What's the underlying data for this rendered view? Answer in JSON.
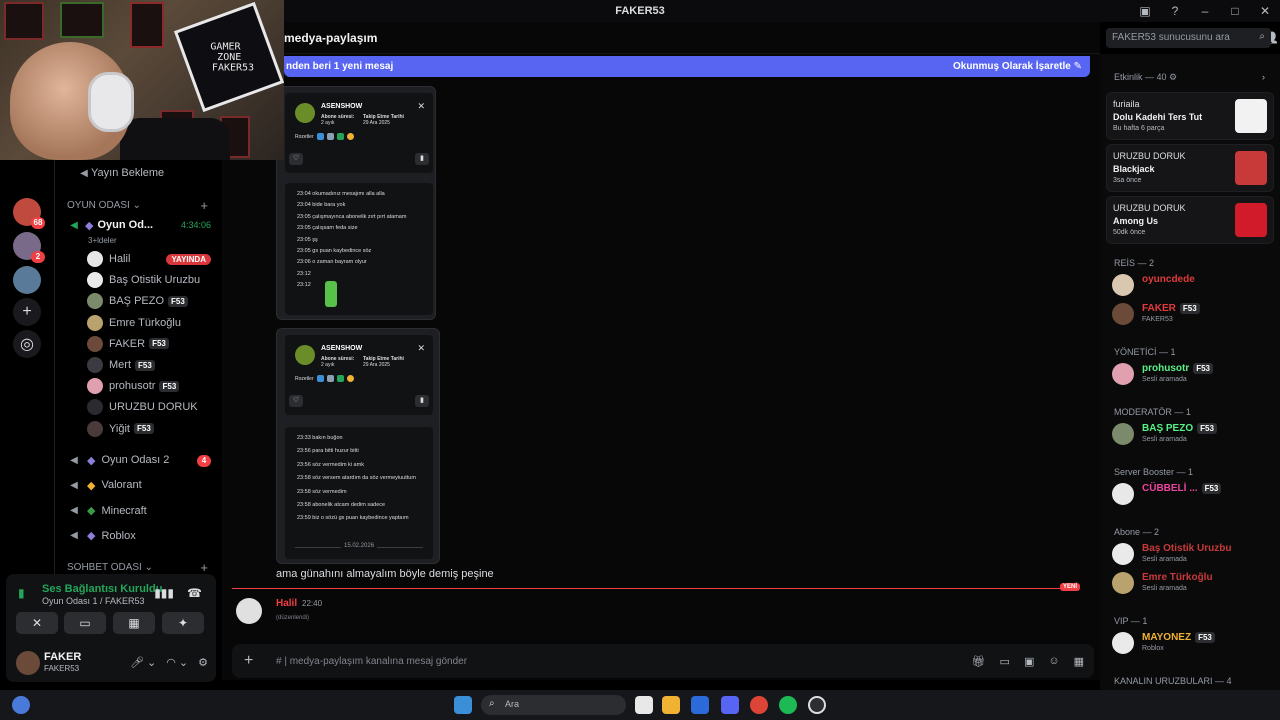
{
  "window": {
    "title": "FAKER53"
  },
  "webcam": {
    "logo_line1": "GAMER",
    "logo_line2": "ZONE",
    "logo_line3": "FAKER53"
  },
  "servers": [
    {
      "badge": "68",
      "color": "#c04a3e"
    },
    {
      "badge": "2",
      "color": "#7a6a8a"
    },
    {
      "badge": "",
      "color": "#5a7a9a"
    }
  ],
  "channels": {
    "top_item": "Yayın Bekleme",
    "category_oyun": "OYUN ODASI",
    "active_channel": "Oyun Od...",
    "active_timer": "4:34:06",
    "active_sub": "3+ldeler",
    "voice_users": [
      {
        "name": "Halil",
        "tag": "",
        "live": "YAYINDA",
        "color": "#dbdee1",
        "av": "#e6e6e6"
      },
      {
        "name": "Baş Otistik Uruzbu",
        "tag": "",
        "live": "",
        "color": "#dbdee1",
        "av": "#eaeaea"
      },
      {
        "name": "BAŞ PEZO",
        "tag": "F53",
        "live": "",
        "color": "#dbdee1",
        "av": "#7a8a6a"
      },
      {
        "name": "Emre Türkoğlu",
        "tag": "",
        "live": "",
        "color": "#dbdee1",
        "av": "#b9a26e"
      },
      {
        "name": "FAKER",
        "tag": "F53",
        "live": "",
        "color": "#dbdee1",
        "av": "#6b4a3a"
      },
      {
        "name": "Mert",
        "tag": "F53",
        "live": "",
        "color": "#dbdee1",
        "av": "#3a3a40"
      },
      {
        "name": "prohusotr",
        "tag": "F53",
        "live": "",
        "color": "#dbdee1",
        "av": "#e0a0b0"
      },
      {
        "name": "URUZBU DORUK",
        "tag": "",
        "live": "",
        "color": "#dbdee1",
        "av": "#2a2a30"
      },
      {
        "name": "Yiğit",
        "tag": "F53",
        "live": "",
        "color": "#dbdee1",
        "av": "#4a3a3a"
      }
    ],
    "other_voice": [
      {
        "name": "Oyun Odası 2",
        "badge": "4"
      },
      {
        "name": "Valorant",
        "badge": ""
      },
      {
        "name": "Minecraft",
        "badge": ""
      },
      {
        "name": "Roblox",
        "badge": ""
      }
    ],
    "category_sohbet": "SOHBET ODASI"
  },
  "voice_panel": {
    "status": "Ses Bağlantısı Kuruldu",
    "location": "Oyun Odası 1 / FAKER53",
    "user_name": "FAKER",
    "user_status": "FAKER53"
  },
  "chat": {
    "channel_name": "medya-paylaşım",
    "search_placeholder": "FAKER53 sunucusunu ara",
    "new_messages_text": "nden beri 1 yeni mesaj",
    "mark_read": "Okunmuş Olarak İşaretle",
    "card1": {
      "name": "ASENSHOW",
      "sub_label": "Abone süresi:",
      "sub_value": "2 ayık",
      "follow_label": "Takip Etme Tarihi",
      "follow_value": "29 Ara 2025",
      "rozetler": "Rozetler",
      "lines": [
        "23:04 okumadınız mesajımı alla alla",
        "23:04 bide bara yok",
        "23:05 çalışmayınca abonelik zırt pırt atamam",
        "23:05 çalışsam feda size",
        "23:05 şş",
        "23:05 gs puan kaybedince söz",
        "23:06 o zaman bayram olyur",
        "23:12",
        "23:12"
      ]
    },
    "card2": {
      "name": "ASENSHOW",
      "sub_label": "Abone süresi:",
      "sub_value": "2 ayık",
      "follow_label": "Takip Etme Tarihi",
      "follow_value": "29 Ara 2025",
      "rozetler": "Rozetler",
      "lines": [
        "23:33 bakın buğon",
        "23:56 para bitti huzur bitti",
        "23:56 söz vermedim ki amk",
        "23:58 söz versem atardım da söz vermeyiuuttum",
        "23:58 söz vermedim",
        "23:58 abonelik atcam dedim sadece",
        "23:59 biz o sözü gs puan kaybedince yaptaım"
      ],
      "date": "15.02.2026"
    },
    "message1": "ama günahını almayalım böyle demiş peşine",
    "new_label": "YENİ",
    "message2": {
      "author": "Halil",
      "time": "22:40",
      "text": "(düzenlendi)"
    },
    "composer_placeholder": "medya-paylaşım kanalına mesaj gönder"
  },
  "members": {
    "activity_header": "Etkinlik — 40",
    "activities": [
      {
        "who": "furiaila",
        "game": "Dolu Kadehi Ters Tut",
        "when": "Bu hafta 6 parça",
        "thumb": "#f2f2f2"
      },
      {
        "who": "URUZBU DORUK",
        "game": "Blackjack",
        "when": "3sa önce",
        "thumb": "#c83a3a"
      },
      {
        "who": "URUZBU DORUK",
        "game": "Among Us",
        "when": "50dk önce",
        "thumb": "#d11a2a"
      }
    ],
    "groups": [
      {
        "title": "REİS — 2",
        "members": [
          {
            "name": "oyuncdede",
            "sub": "",
            "tag": "",
            "color": "#e03a3a",
            "av": "#d9c7b0"
          },
          {
            "name": "FAKER",
            "sub": "FAKER53",
            "tag": "F53",
            "color": "#e03a3a",
            "av": "#6b4a3a"
          }
        ]
      },
      {
        "title": "YÖNETİCİ — 1",
        "members": [
          {
            "name": "prohusotr",
            "sub": "Sesli aramada",
            "tag": "F53",
            "color": "#57f287",
            "av": "#e0a0b0"
          }
        ]
      },
      {
        "title": "MODERATÖR — 1",
        "members": [
          {
            "name": "BAŞ PEZO",
            "sub": "Sesli aramada",
            "tag": "F53",
            "color": "#57f287",
            "av": "#7a8a6a"
          }
        ]
      },
      {
        "title": "Server Booster — 1",
        "members": [
          {
            "name": "CÜBBELİ ...",
            "sub": "",
            "tag": "F53",
            "color": "#eb459e",
            "av": "#e8e8e8"
          }
        ]
      },
      {
        "title": "Abone — 2",
        "members": [
          {
            "name": "Baş Otistik Uruzbu",
            "sub": "Sesli aramada",
            "tag": "",
            "color": "#c83a3a",
            "av": "#eaeaea"
          },
          {
            "name": "Emre Türkoğlu",
            "sub": "Sesli aramada",
            "tag": "",
            "color": "#c83a3a",
            "av": "#b9a26e"
          }
        ]
      },
      {
        "title": "VIP — 1",
        "members": [
          {
            "name": "MAYONEZ",
            "sub": "Roblox",
            "tag": "F53",
            "color": "#f0b232",
            "av": "#eaeaea"
          }
        ]
      },
      {
        "title": "KANALIN URUZBULARI — 4",
        "members": []
      }
    ]
  },
  "taskbar": {
    "search": "Ara"
  }
}
